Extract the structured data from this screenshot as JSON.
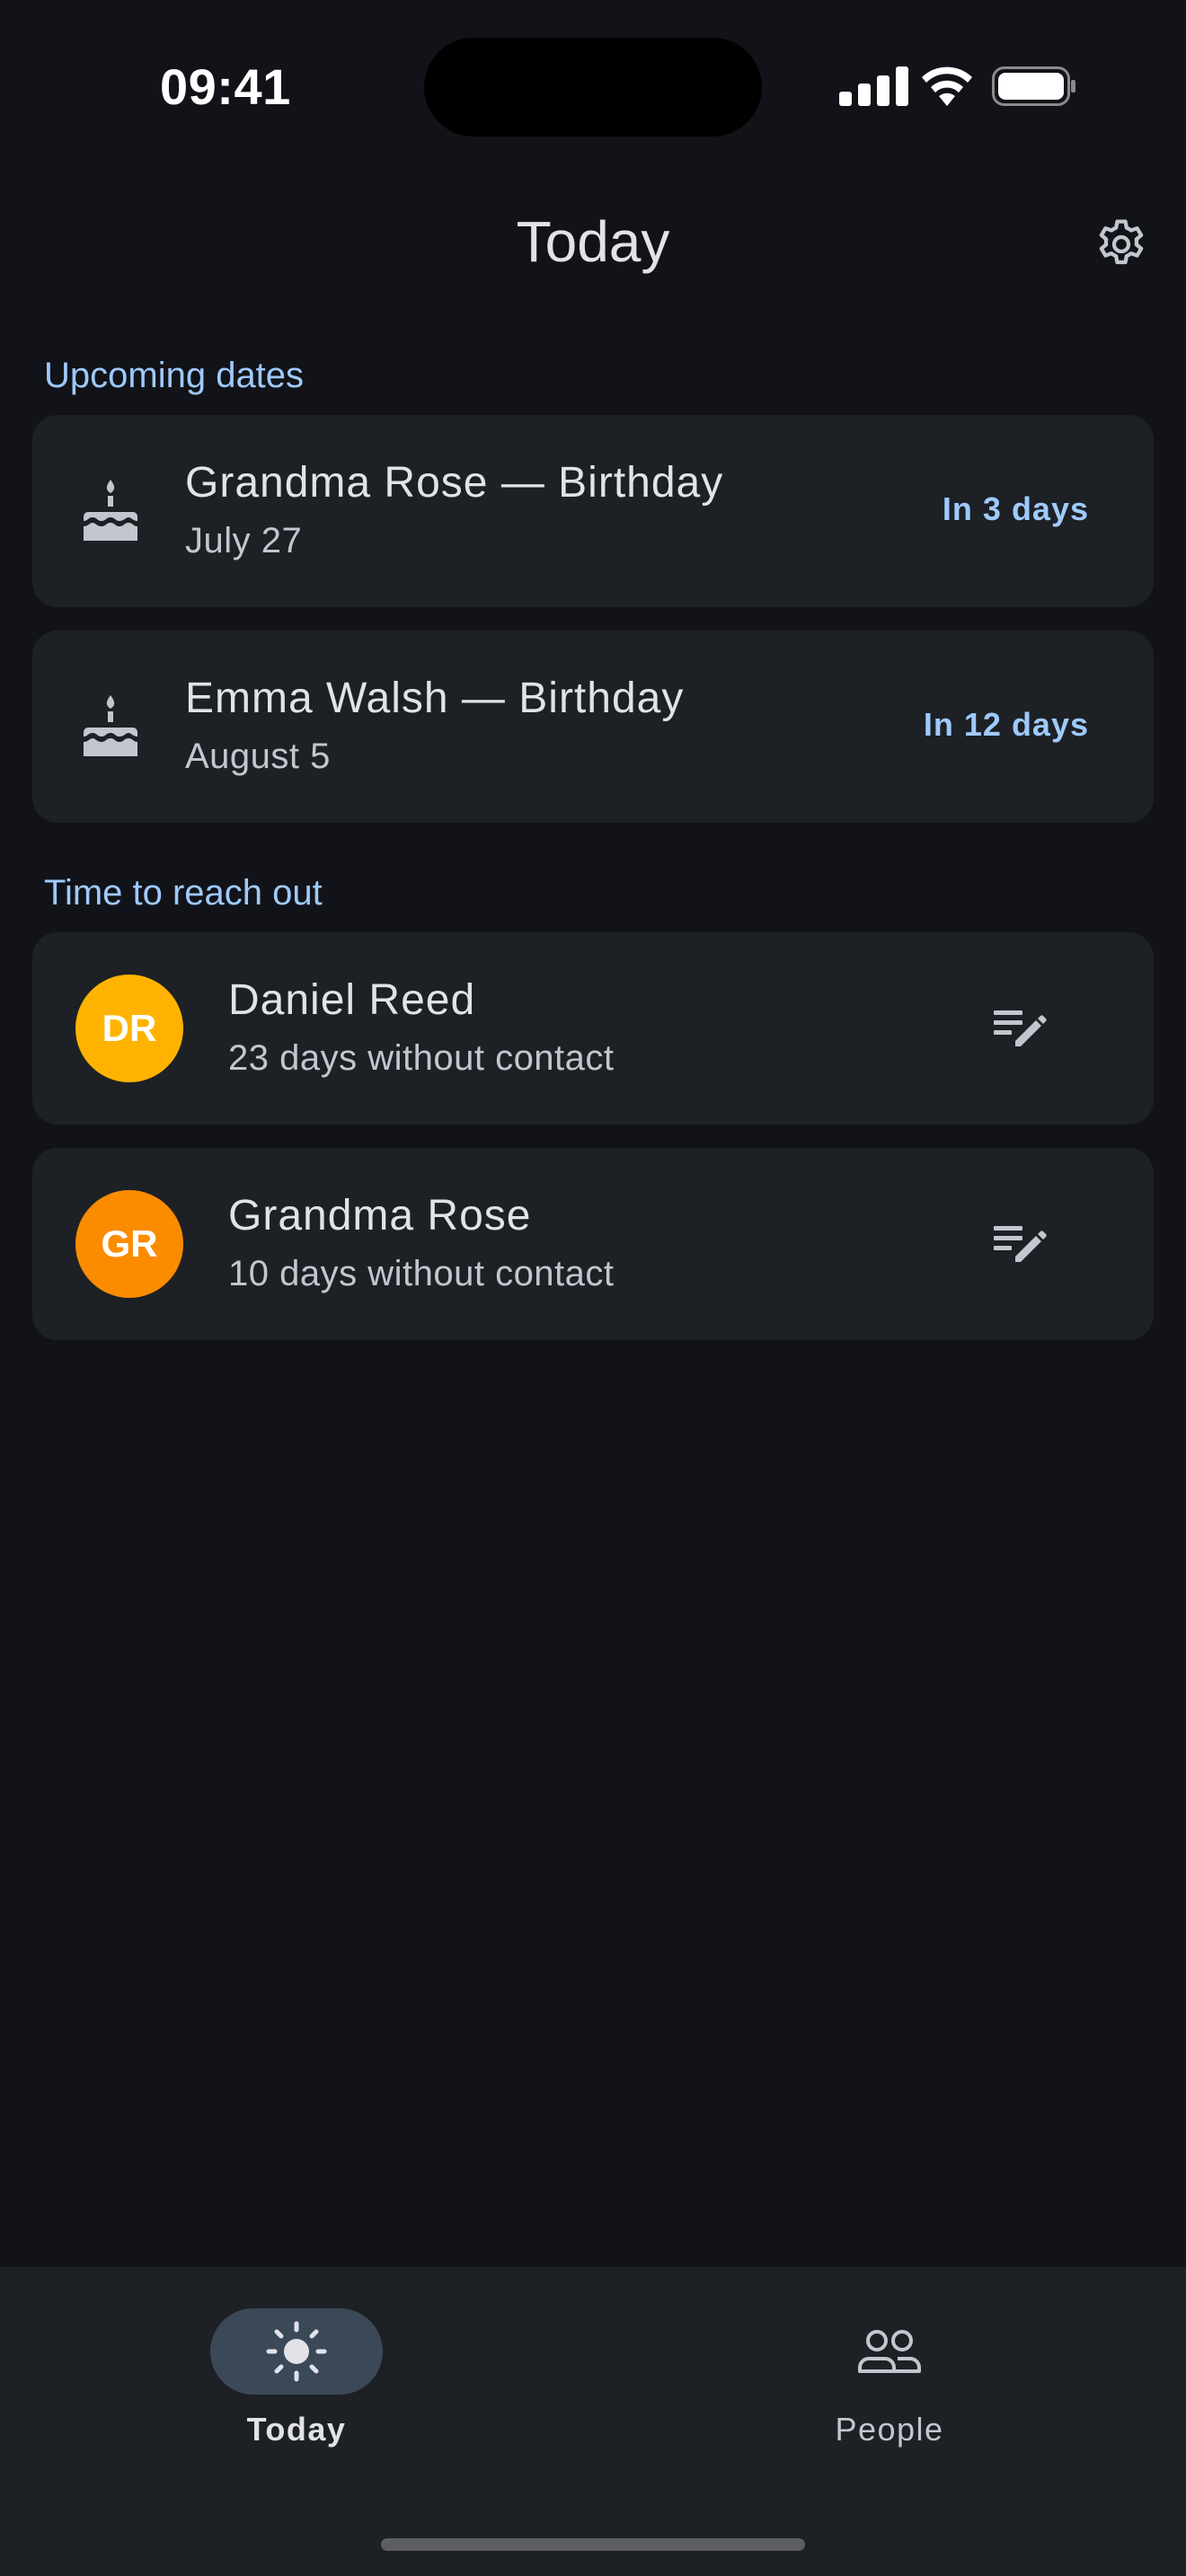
{
  "status_bar": {
    "time": "09:41"
  },
  "app_bar": {
    "title": "Today",
    "settings_icon": "gear-icon"
  },
  "sections": {
    "upcoming": "Upcoming dates",
    "reach_out": "Time to reach out"
  },
  "upcoming_dates": [
    {
      "icon": "cake-icon",
      "title": "Grandma Rose — Birthday",
      "date": "July 27",
      "countdown": "In 3 days"
    },
    {
      "icon": "cake-icon",
      "title": "Emma Walsh — Birthday",
      "date": "August 5",
      "countdown": "In 12 days"
    }
  ],
  "reach_out": [
    {
      "initials": "DR",
      "name": "Daniel Reed",
      "status": "23 days without contact",
      "avatar_color": "#ffb300",
      "action_icon": "edit-note-icon"
    },
    {
      "initials": "GR",
      "name": "Grandma Rose",
      "status": "10 days without contact",
      "avatar_color": "#fb8c00",
      "action_icon": "edit-note-icon"
    }
  ],
  "bottom_nav": [
    {
      "label": "Today",
      "icon": "sun-icon",
      "active": true
    },
    {
      "label": "People",
      "icon": "people-icon",
      "active": false
    }
  ],
  "colors": {
    "background": "#111318",
    "surface": "#1d2024",
    "accent": "#9ecaff",
    "active_pill": "#3b4858"
  }
}
